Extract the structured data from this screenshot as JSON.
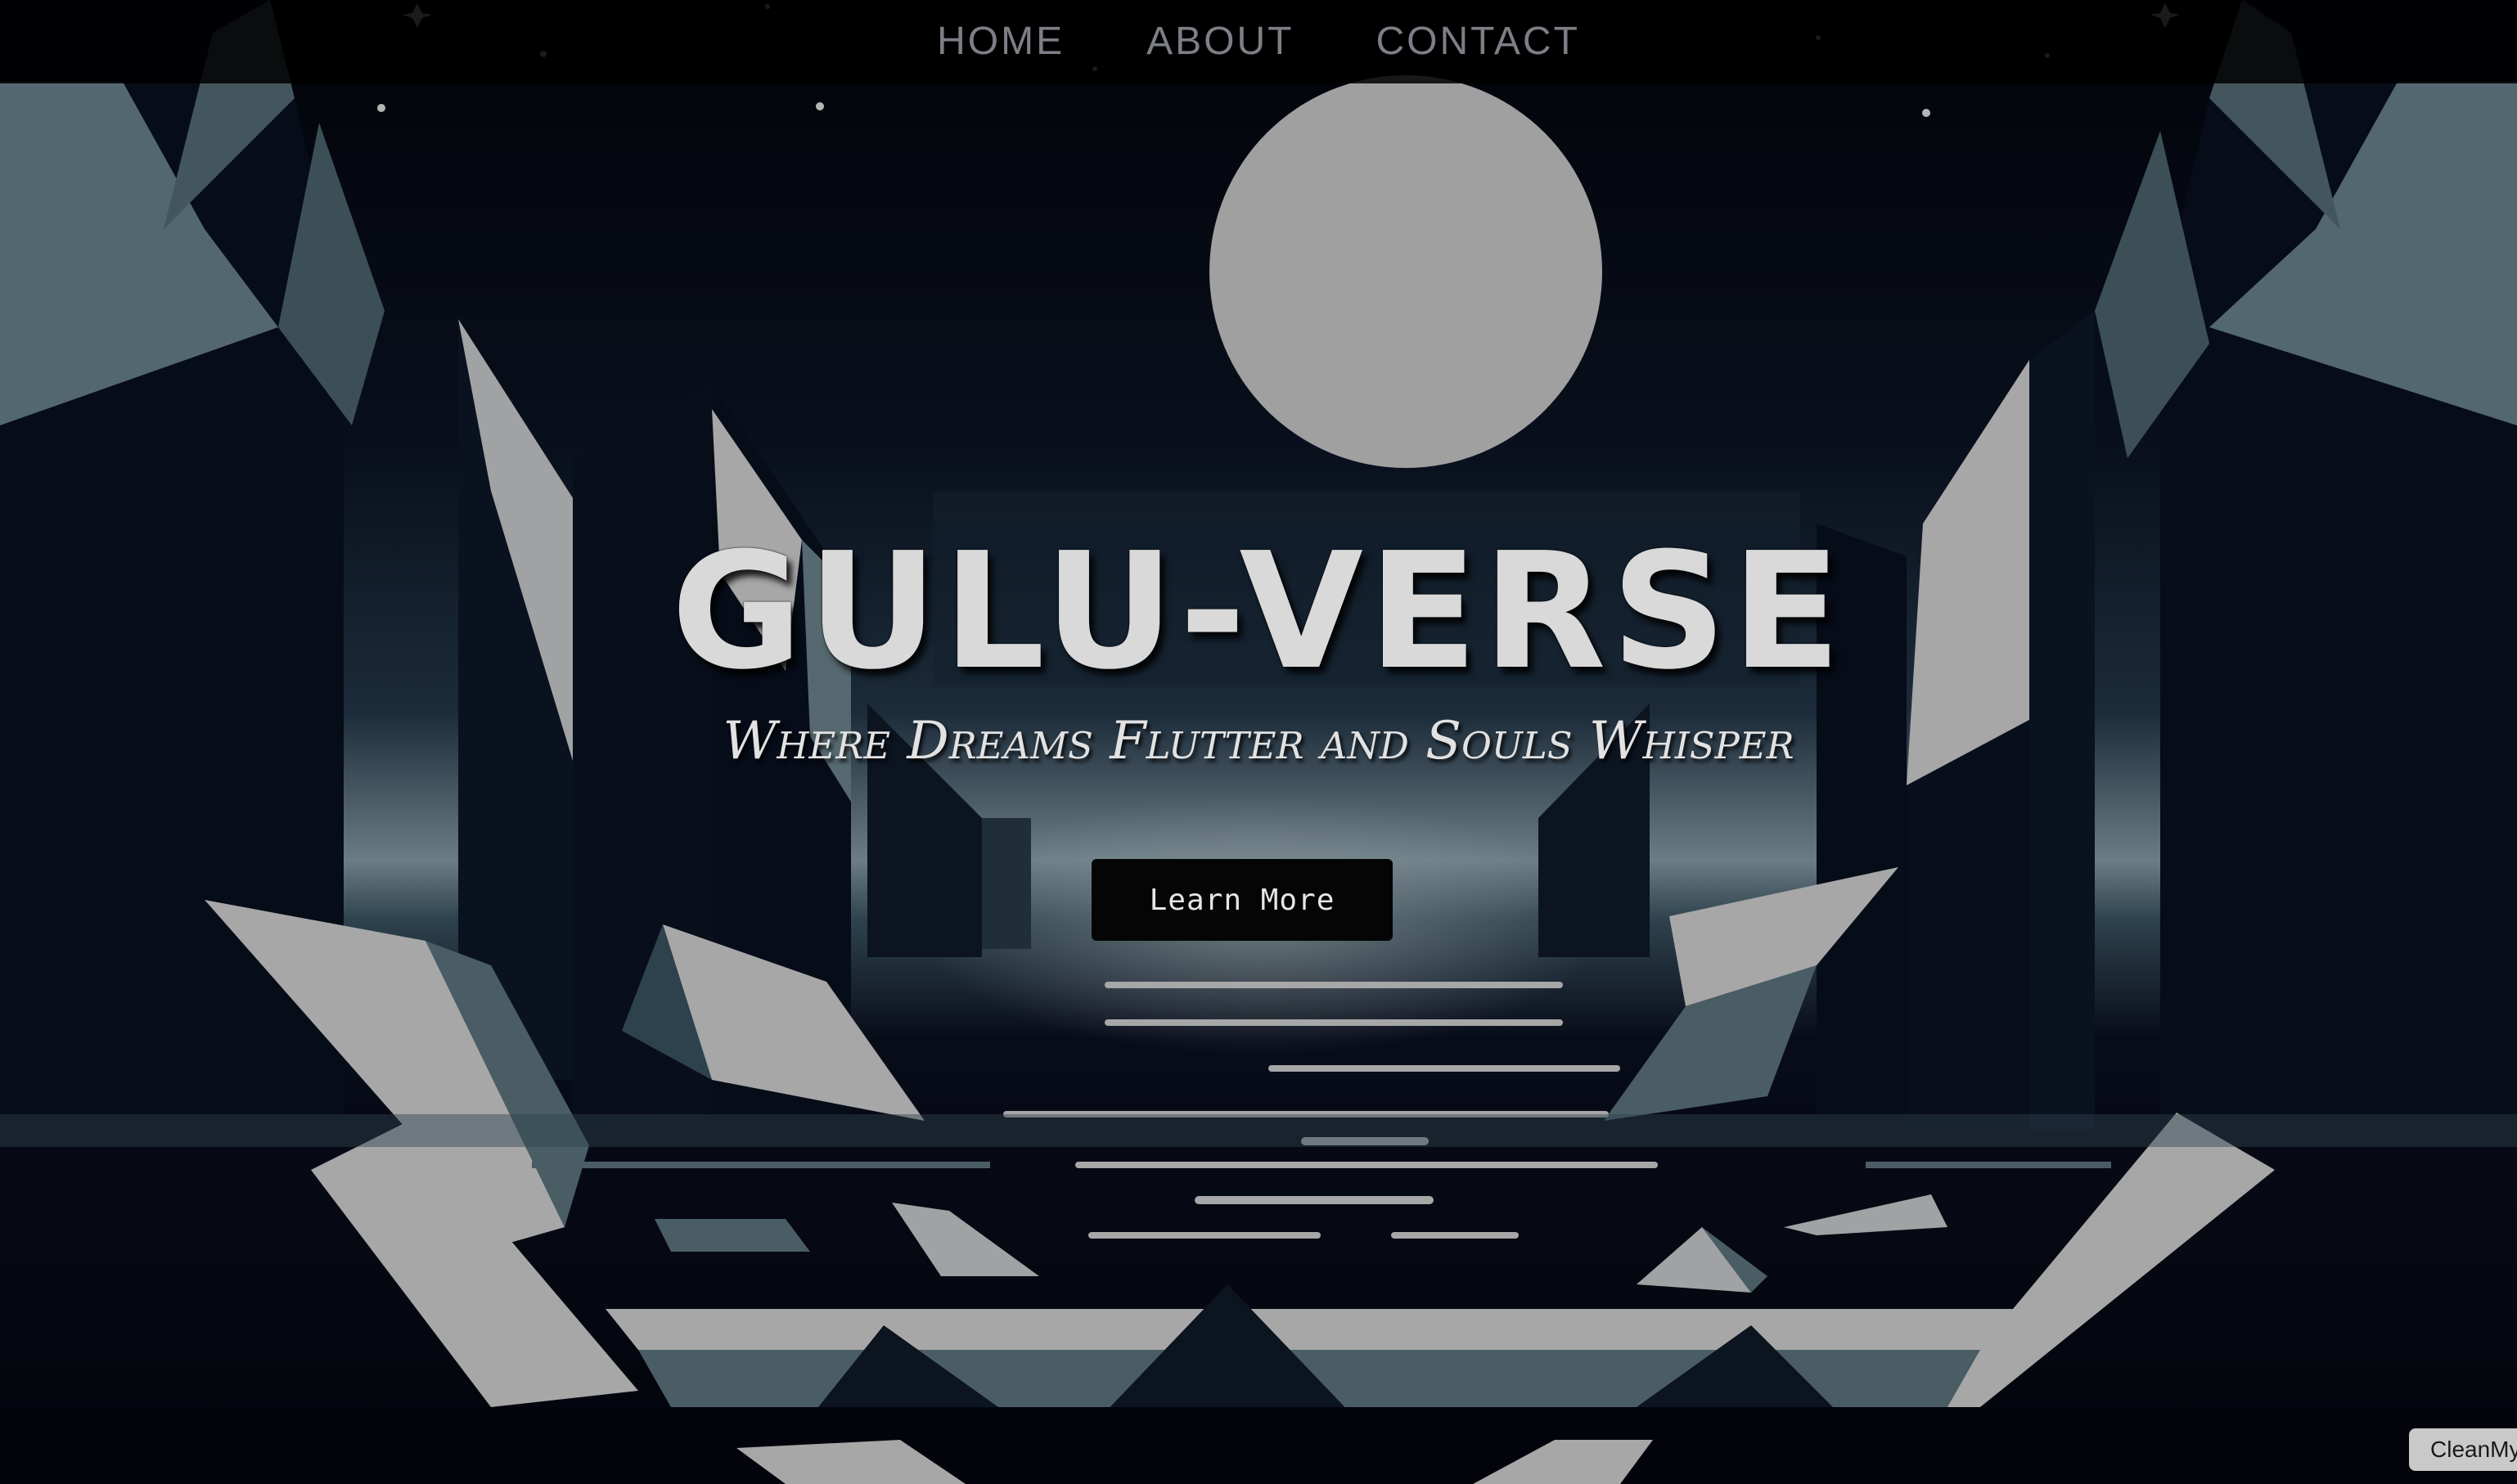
{
  "nav": {
    "items": [
      {
        "label": "HOME"
      },
      {
        "label": "ABOUT"
      },
      {
        "label": "CONTACT"
      }
    ]
  },
  "hero": {
    "title": "GULU-VERSE",
    "tagline": "Where Dreams Flutter and Souls Whisper",
    "cta_label": "Learn More"
  },
  "overlay_badge": {
    "label": "CleanMy"
  },
  "colors": {
    "background": "#050713",
    "moon": "#cdcdcf",
    "crystal_light": "#d6d6d8",
    "crystal_mid": "#5f7880",
    "title_text": "#d9d9d9",
    "nav_text": "#7d7f86"
  }
}
